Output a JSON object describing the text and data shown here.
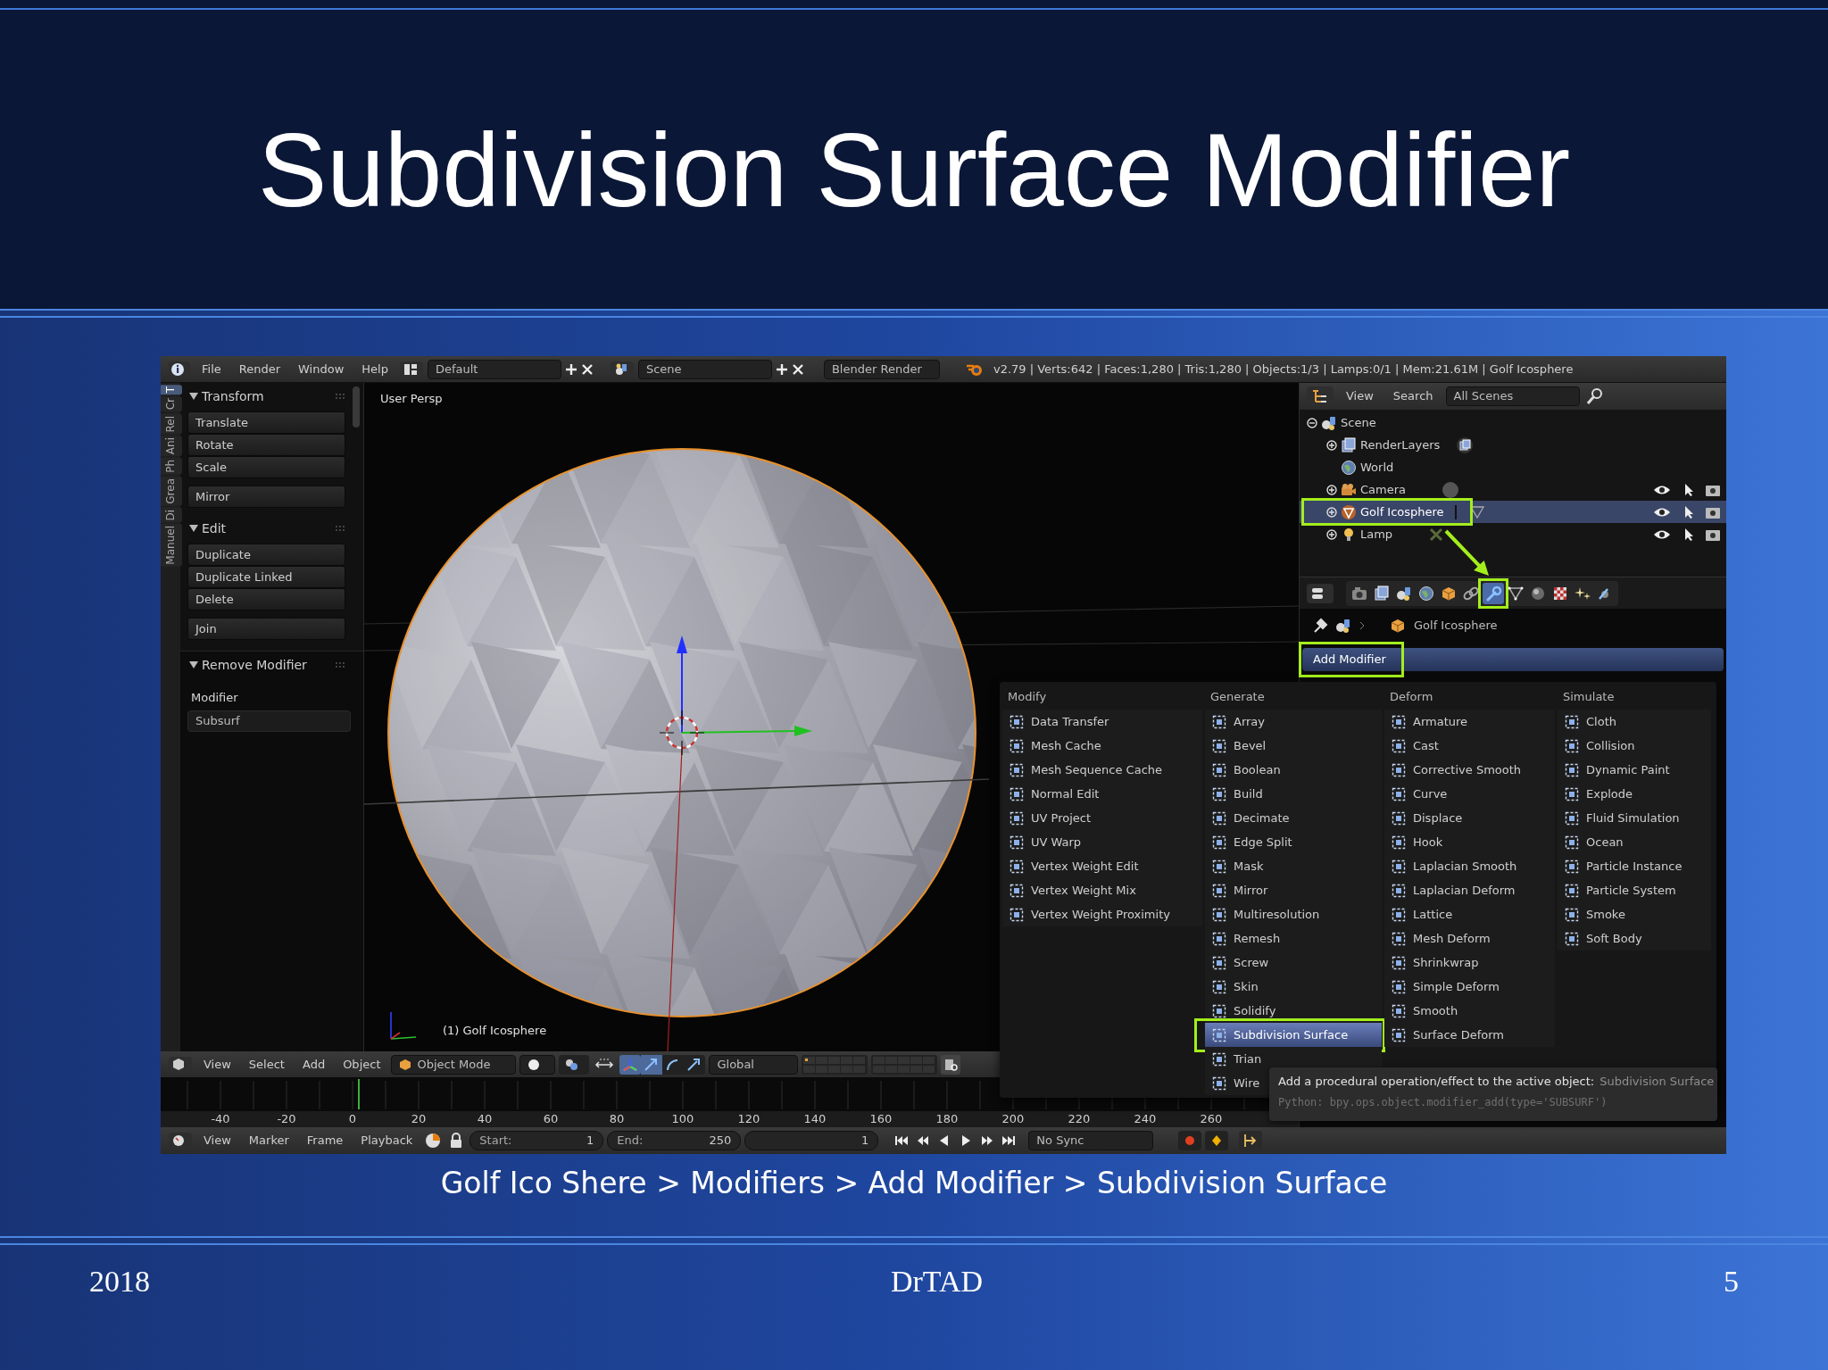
{
  "slide": {
    "title": "Subdivision Surface Modifier",
    "caption": "Golf Ico Shere > Modifiers > Add Modifier > Subdivision Surface",
    "footer": {
      "date": "2018",
      "author": "DrTAD",
      "page": "5"
    }
  },
  "top_bar": {
    "menus": [
      "File",
      "Render",
      "Window",
      "Help"
    ],
    "layout": "Default",
    "scene": "Scene",
    "engine": "Blender Render",
    "stats": "v2.79 | Verts:642 | Faces:1,280 | Tris:1,280 | Objects:1/3 | Lamps:0/1 | Mem:21.61M | Golf Icosphere"
  },
  "tool_shelf": {
    "tabs": [
      {
        "label": "T",
        "selected": true
      },
      {
        "label": "Cr",
        "selected": false
      },
      {
        "label": "Rel",
        "selected": false
      },
      {
        "label": "Ani",
        "selected": false
      },
      {
        "label": "Ph",
        "selected": false
      },
      {
        "label": "Grea",
        "selected": false
      },
      {
        "label": "Di",
        "selected": false
      },
      {
        "label": "Manuel",
        "selected": false
      }
    ],
    "panels": [
      {
        "title": "Transform",
        "expanded": true,
        "button_groups": [
          [
            "Translate",
            "Rotate",
            "Scale"
          ],
          [
            "Mirror"
          ]
        ]
      },
      {
        "title": "Edit",
        "expanded": true,
        "button_groups": [
          [
            "Duplicate",
            "Duplicate Linked",
            "Delete"
          ],
          [
            "Join"
          ]
        ]
      }
    ],
    "operator_panel": {
      "title": "Remove Modifier",
      "expanded": true,
      "label": "Modifier",
      "value": "Subsurf"
    }
  },
  "viewport": {
    "view_label": "User Persp",
    "object_label": "(1) Golf Icosphere"
  },
  "viewport_header": {
    "menus": [
      "View",
      "Select",
      "Add",
      "Object"
    ],
    "mode": "Object Mode",
    "orientation": "Global"
  },
  "timeline": {
    "ruler": [
      "-40",
      "-20",
      "0",
      "20",
      "40",
      "60",
      "80",
      "100",
      "120",
      "140",
      "160",
      "180",
      "200",
      "220",
      "240",
      "260"
    ],
    "menus": [
      "View",
      "Marker",
      "Frame",
      "Playback"
    ],
    "start_label": "Start:",
    "start": "1",
    "end_label": "End:",
    "end": "250",
    "current": "1",
    "sync": "No Sync"
  },
  "outliner": {
    "menus": [
      "View",
      "Search"
    ],
    "filter": "All Scenes",
    "tree": [
      {
        "label": "Scene",
        "kind": "scene",
        "expanded": true,
        "children": [
          {
            "label": "RenderLayers",
            "kind": "render_layers",
            "expanded": false,
            "selected": false,
            "toggles": false
          },
          {
            "label": "World",
            "kind": "world",
            "selected": false,
            "toggles": false
          },
          {
            "label": "Camera",
            "kind": "camera",
            "expanded": false,
            "selected": false,
            "toggles": true
          },
          {
            "label": "Golf Icosphere",
            "kind": "mesh",
            "expanded": false,
            "selected": true,
            "toggles": true
          },
          {
            "label": "Lamp",
            "kind": "lamp",
            "expanded": false,
            "selected": false,
            "toggles": true
          }
        ]
      }
    ]
  },
  "properties": {
    "tabs": [
      {
        "kind": "render",
        "selected": false
      },
      {
        "kind": "render_layers",
        "selected": false
      },
      {
        "kind": "scene",
        "selected": false
      },
      {
        "kind": "world",
        "selected": false
      },
      {
        "kind": "object",
        "selected": false
      },
      {
        "kind": "constraints",
        "selected": false
      },
      {
        "kind": "modifiers",
        "selected": true
      },
      {
        "kind": "data",
        "selected": false
      },
      {
        "kind": "material",
        "selected": false
      },
      {
        "kind": "texture",
        "selected": false
      },
      {
        "kind": "particles",
        "selected": false
      },
      {
        "kind": "physics",
        "selected": false
      }
    ],
    "breadcrumb": "Golf Icosphere",
    "add_button": "Add Modifier"
  },
  "modifier_menu": {
    "columns": [
      {
        "heading": "Modify",
        "items": [
          {
            "label": "Data Transfer",
            "selected": false
          },
          {
            "label": "Mesh Cache",
            "selected": false
          },
          {
            "label": "Mesh Sequence Cache",
            "selected": false
          },
          {
            "label": "Normal Edit",
            "selected": false
          },
          {
            "label": "UV Project",
            "selected": false
          },
          {
            "label": "UV Warp",
            "selected": false
          },
          {
            "label": "Vertex Weight Edit",
            "selected": false
          },
          {
            "label": "Vertex Weight Mix",
            "selected": false
          },
          {
            "label": "Vertex Weight Proximity",
            "selected": false
          }
        ]
      },
      {
        "heading": "Generate",
        "items": [
          {
            "label": "Array",
            "selected": false
          },
          {
            "label": "Bevel",
            "selected": false
          },
          {
            "label": "Boolean",
            "selected": false
          },
          {
            "label": "Build",
            "selected": false
          },
          {
            "label": "Decimate",
            "selected": false
          },
          {
            "label": "Edge Split",
            "selected": false
          },
          {
            "label": "Mask",
            "selected": false
          },
          {
            "label": "Mirror",
            "selected": false
          },
          {
            "label": "Multiresolution",
            "selected": false
          },
          {
            "label": "Remesh",
            "selected": false
          },
          {
            "label": "Screw",
            "selected": false
          },
          {
            "label": "Skin",
            "selected": false
          },
          {
            "label": "Solidify",
            "selected": false
          },
          {
            "label": "Subdivision Surface",
            "selected": true
          },
          {
            "label": "Trian",
            "selected": false
          },
          {
            "label": "Wire",
            "selected": false
          }
        ]
      },
      {
        "heading": "Deform",
        "items": [
          {
            "label": "Armature",
            "selected": false
          },
          {
            "label": "Cast",
            "selected": false
          },
          {
            "label": "Corrective Smooth",
            "selected": false
          },
          {
            "label": "Curve",
            "selected": false
          },
          {
            "label": "Displace",
            "selected": false
          },
          {
            "label": "Hook",
            "selected": false
          },
          {
            "label": "Laplacian Smooth",
            "selected": false
          },
          {
            "label": "Laplacian Deform",
            "selected": false
          },
          {
            "label": "Lattice",
            "selected": false
          },
          {
            "label": "Mesh Deform",
            "selected": false
          },
          {
            "label": "Shrinkwrap",
            "selected": false
          },
          {
            "label": "Simple Deform",
            "selected": false
          },
          {
            "label": "Smooth",
            "selected": false
          },
          {
            "label": "Surface Deform",
            "selected": false
          }
        ]
      },
      {
        "heading": "Simulate",
        "items": [
          {
            "label": "Cloth",
            "selected": false
          },
          {
            "label": "Collision",
            "selected": false
          },
          {
            "label": "Dynamic Paint",
            "selected": false
          },
          {
            "label": "Explode",
            "selected": false
          },
          {
            "label": "Fluid Simulation",
            "selected": false
          },
          {
            "label": "Ocean",
            "selected": false
          },
          {
            "label": "Particle Instance",
            "selected": false
          },
          {
            "label": "Particle System",
            "selected": false
          },
          {
            "label": "Smoke",
            "selected": false
          },
          {
            "label": "Soft Body",
            "selected": false
          }
        ]
      }
    ],
    "tooltip": {
      "text": "Add a procedural operation/effect to the active object:",
      "detail": "Subdivision Surface",
      "python": "Python: bpy.ops.object.modifier_add(type='SUBSURF')"
    }
  }
}
